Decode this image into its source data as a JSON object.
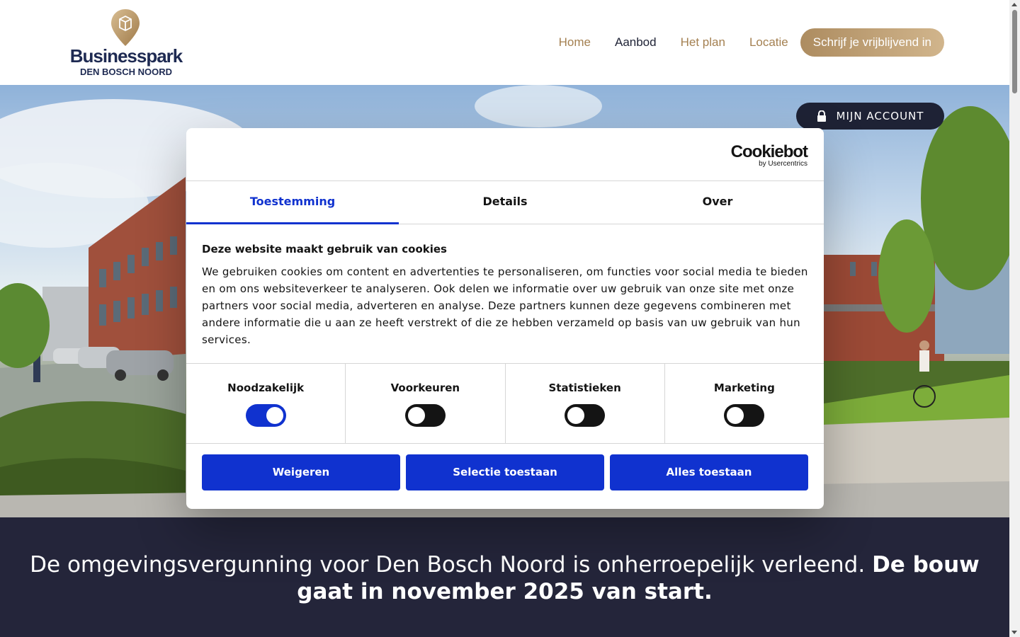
{
  "header": {
    "logo": {
      "title": "Businesspark",
      "subtitle": "DEN BOSCH NOORD"
    },
    "nav": [
      {
        "label": "Home"
      },
      {
        "label": "Aanbod"
      },
      {
        "label": "Het plan"
      },
      {
        "label": "Locatie"
      }
    ],
    "cta_label": "Schrijf je vrijblijvend in"
  },
  "hero": {
    "account_label": "MIJN ACCOUNT",
    "account_icon": "lock-icon"
  },
  "band": {
    "text_regular": "De omgevingsvergunning voor Den Bosch Noord is onherroepelijk verleend.",
    "text_bold": "De bouw gaat in november 2025 van start."
  },
  "cookie": {
    "brand": "Cookiebot",
    "brand_sub": "by Usercentrics",
    "tabs": [
      {
        "label": "Toestemming"
      },
      {
        "label": "Details"
      },
      {
        "label": "Over"
      }
    ],
    "heading": "Deze website maakt gebruik van cookies",
    "body": "We gebruiken cookies om content en advertenties te personaliseren, om functies voor social media te bieden en om ons websiteverkeer te analyseren. Ook delen we informatie over uw gebruik van onze site met onze partners voor social media, adverteren en analyse. Deze partners kunnen deze gegevens combineren met andere informatie die u aan ze heeft verstrekt of die ze hebben verzameld op basis van uw gebruik van hun services.",
    "categories": [
      {
        "label": "Noodzakelijk",
        "enabled": true
      },
      {
        "label": "Voorkeuren",
        "enabled": false
      },
      {
        "label": "Statistieken",
        "enabled": false
      },
      {
        "label": "Marketing",
        "enabled": false
      }
    ],
    "buttons": {
      "reject": "Weigeren",
      "selection": "Selectie toestaan",
      "accept_all": "Alles toestaan"
    }
  },
  "colors": {
    "brand_navy": "#1e2a52",
    "brand_gold": "#a48051",
    "cookiebot_blue": "#1032cf",
    "band_dark": "#24253a"
  }
}
